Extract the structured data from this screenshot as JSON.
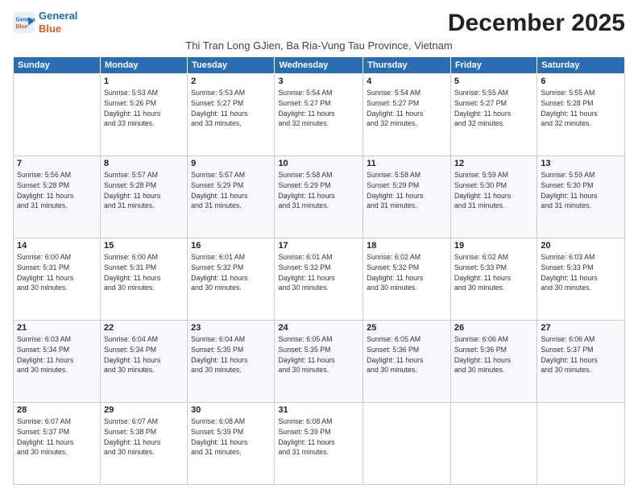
{
  "header": {
    "logo_line1": "General",
    "logo_line2": "Blue",
    "title": "December 2025",
    "subtitle": "Thi Tran Long GJien, Ba Ria-Vung Tau Province, Vietnam"
  },
  "columns": [
    "Sunday",
    "Monday",
    "Tuesday",
    "Wednesday",
    "Thursday",
    "Friday",
    "Saturday"
  ],
  "weeks": [
    [
      {
        "day": "",
        "info": ""
      },
      {
        "day": "1",
        "info": "Sunrise: 5:53 AM\nSunset: 5:26 PM\nDaylight: 11 hours\nand 33 minutes."
      },
      {
        "day": "2",
        "info": "Sunrise: 5:53 AM\nSunset: 5:27 PM\nDaylight: 11 hours\nand 33 minutes."
      },
      {
        "day": "3",
        "info": "Sunrise: 5:54 AM\nSunset: 5:27 PM\nDaylight: 11 hours\nand 32 minutes."
      },
      {
        "day": "4",
        "info": "Sunrise: 5:54 AM\nSunset: 5:27 PM\nDaylight: 11 hours\nand 32 minutes."
      },
      {
        "day": "5",
        "info": "Sunrise: 5:55 AM\nSunset: 5:27 PM\nDaylight: 11 hours\nand 32 minutes."
      },
      {
        "day": "6",
        "info": "Sunrise: 5:55 AM\nSunset: 5:28 PM\nDaylight: 11 hours\nand 32 minutes."
      }
    ],
    [
      {
        "day": "7",
        "info": "Sunrise: 5:56 AM\nSunset: 5:28 PM\nDaylight: 11 hours\nand 31 minutes."
      },
      {
        "day": "8",
        "info": "Sunrise: 5:57 AM\nSunset: 5:28 PM\nDaylight: 11 hours\nand 31 minutes."
      },
      {
        "day": "9",
        "info": "Sunrise: 5:57 AM\nSunset: 5:29 PM\nDaylight: 11 hours\nand 31 minutes."
      },
      {
        "day": "10",
        "info": "Sunrise: 5:58 AM\nSunset: 5:29 PM\nDaylight: 11 hours\nand 31 minutes."
      },
      {
        "day": "11",
        "info": "Sunrise: 5:58 AM\nSunset: 5:29 PM\nDaylight: 11 hours\nand 31 minutes."
      },
      {
        "day": "12",
        "info": "Sunrise: 5:59 AM\nSunset: 5:30 PM\nDaylight: 11 hours\nand 31 minutes."
      },
      {
        "day": "13",
        "info": "Sunrise: 5:59 AM\nSunset: 5:30 PM\nDaylight: 11 hours\nand 31 minutes."
      }
    ],
    [
      {
        "day": "14",
        "info": "Sunrise: 6:00 AM\nSunset: 5:31 PM\nDaylight: 11 hours\nand 30 minutes."
      },
      {
        "day": "15",
        "info": "Sunrise: 6:00 AM\nSunset: 5:31 PM\nDaylight: 11 hours\nand 30 minutes."
      },
      {
        "day": "16",
        "info": "Sunrise: 6:01 AM\nSunset: 5:32 PM\nDaylight: 11 hours\nand 30 minutes."
      },
      {
        "day": "17",
        "info": "Sunrise: 6:01 AM\nSunset: 5:32 PM\nDaylight: 11 hours\nand 30 minutes."
      },
      {
        "day": "18",
        "info": "Sunrise: 6:02 AM\nSunset: 5:32 PM\nDaylight: 11 hours\nand 30 minutes."
      },
      {
        "day": "19",
        "info": "Sunrise: 6:02 AM\nSunset: 5:33 PM\nDaylight: 11 hours\nand 30 minutes."
      },
      {
        "day": "20",
        "info": "Sunrise: 6:03 AM\nSunset: 5:33 PM\nDaylight: 11 hours\nand 30 minutes."
      }
    ],
    [
      {
        "day": "21",
        "info": "Sunrise: 6:03 AM\nSunset: 5:34 PM\nDaylight: 11 hours\nand 30 minutes."
      },
      {
        "day": "22",
        "info": "Sunrise: 6:04 AM\nSunset: 5:34 PM\nDaylight: 11 hours\nand 30 minutes."
      },
      {
        "day": "23",
        "info": "Sunrise: 6:04 AM\nSunset: 5:35 PM\nDaylight: 11 hours\nand 30 minutes."
      },
      {
        "day": "24",
        "info": "Sunrise: 6:05 AM\nSunset: 5:35 PM\nDaylight: 11 hours\nand 30 minutes."
      },
      {
        "day": "25",
        "info": "Sunrise: 6:05 AM\nSunset: 5:36 PM\nDaylight: 11 hours\nand 30 minutes."
      },
      {
        "day": "26",
        "info": "Sunrise: 6:06 AM\nSunset: 5:36 PM\nDaylight: 11 hours\nand 30 minutes."
      },
      {
        "day": "27",
        "info": "Sunrise: 6:06 AM\nSunset: 5:37 PM\nDaylight: 11 hours\nand 30 minutes."
      }
    ],
    [
      {
        "day": "28",
        "info": "Sunrise: 6:07 AM\nSunset: 5:37 PM\nDaylight: 11 hours\nand 30 minutes."
      },
      {
        "day": "29",
        "info": "Sunrise: 6:07 AM\nSunset: 5:38 PM\nDaylight: 11 hours\nand 30 minutes."
      },
      {
        "day": "30",
        "info": "Sunrise: 6:08 AM\nSunset: 5:39 PM\nDaylight: 11 hours\nand 31 minutes."
      },
      {
        "day": "31",
        "info": "Sunrise: 6:08 AM\nSunset: 5:39 PM\nDaylight: 11 hours\nand 31 minutes."
      },
      {
        "day": "",
        "info": ""
      },
      {
        "day": "",
        "info": ""
      },
      {
        "day": "",
        "info": ""
      }
    ]
  ]
}
